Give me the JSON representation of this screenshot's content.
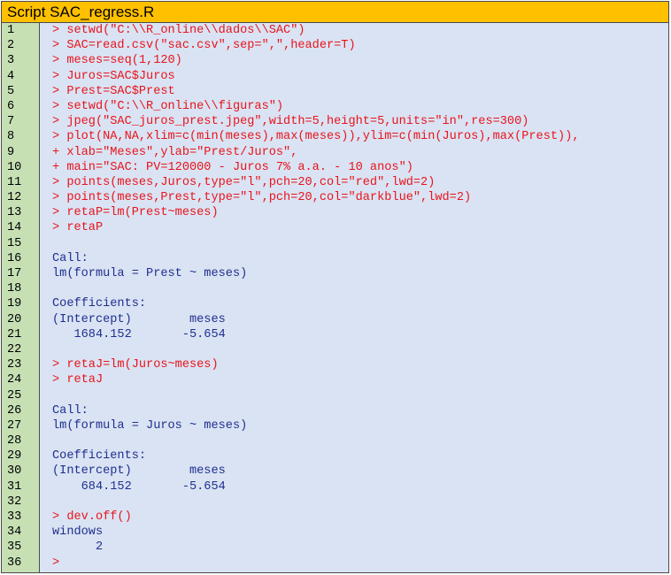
{
  "title": "Script SAC_regress.R",
  "colors": {
    "title_bg": "#ffc000",
    "gutter_bg": "#c6e0b4",
    "code_bg": "#dae3f3",
    "command": "#e8141c",
    "output": "#1f2f8f"
  },
  "lines": [
    {
      "n": "1",
      "text": "> setwd(\"C:\\\\R_online\\\\dados\\\\SAC\")",
      "kind": "cmd"
    },
    {
      "n": "2",
      "text": "> SAC=read.csv(\"sac.csv\",sep=\",\",header=T)",
      "kind": "cmd"
    },
    {
      "n": "3",
      "text": "> meses=seq(1,120)",
      "kind": "cmd"
    },
    {
      "n": "4",
      "text": "> Juros=SAC$Juros",
      "kind": "cmd"
    },
    {
      "n": "5",
      "text": "> Prest=SAC$Prest",
      "kind": "cmd"
    },
    {
      "n": "6",
      "text": "> setwd(\"C:\\\\R_online\\\\figuras\")",
      "kind": "cmd"
    },
    {
      "n": "7",
      "text": "> jpeg(\"SAC_juros_prest.jpeg\",width=5,height=5,units=\"in\",res=300)",
      "kind": "cmd"
    },
    {
      "n": "8",
      "text": "> plot(NA,NA,xlim=c(min(meses),max(meses)),ylim=c(min(Juros),max(Prest)),",
      "kind": "cmd"
    },
    {
      "n": "9",
      "text": "+ xlab=\"Meses\",ylab=\"Prest/Juros\",",
      "kind": "cmd"
    },
    {
      "n": "10",
      "text": "+ main=\"SAC: PV=120000 - Juros 7% a.a. - 10 anos\")",
      "kind": "cmd"
    },
    {
      "n": "11",
      "text": "> points(meses,Juros,type=\"l\",pch=20,col=\"red\",lwd=2)",
      "kind": "cmd"
    },
    {
      "n": "12",
      "text": "> points(meses,Prest,type=\"l\",pch=20,col=\"darkblue\",lwd=2)",
      "kind": "cmd"
    },
    {
      "n": "13",
      "text": "> retaP=lm(Prest~meses)",
      "kind": "cmd"
    },
    {
      "n": "14",
      "text": "> retaP",
      "kind": "cmd"
    },
    {
      "n": "15",
      "text": "",
      "kind": "out"
    },
    {
      "n": "16",
      "text": "Call:",
      "kind": "out"
    },
    {
      "n": "17",
      "text": "lm(formula = Prest ~ meses)",
      "kind": "out"
    },
    {
      "n": "18",
      "text": "",
      "kind": "out"
    },
    {
      "n": "19",
      "text": "Coefficients:",
      "kind": "out"
    },
    {
      "n": "20",
      "text": "(Intercept)        meses",
      "kind": "out"
    },
    {
      "n": "21",
      "text": "   1684.152       -5.654",
      "kind": "out"
    },
    {
      "n": "22",
      "text": "",
      "kind": "out"
    },
    {
      "n": "23",
      "text": "> retaJ=lm(Juros~meses)",
      "kind": "cmd"
    },
    {
      "n": "24",
      "text": "> retaJ",
      "kind": "cmd"
    },
    {
      "n": "25",
      "text": "",
      "kind": "out"
    },
    {
      "n": "26",
      "text": "Call:",
      "kind": "out"
    },
    {
      "n": "27",
      "text": "lm(formula = Juros ~ meses)",
      "kind": "out"
    },
    {
      "n": "28",
      "text": "",
      "kind": "out"
    },
    {
      "n": "29",
      "text": "Coefficients:",
      "kind": "out"
    },
    {
      "n": "30",
      "text": "(Intercept)        meses",
      "kind": "out"
    },
    {
      "n": "31",
      "text": "    684.152       -5.654",
      "kind": "out"
    },
    {
      "n": "32",
      "text": "",
      "kind": "out"
    },
    {
      "n": "33",
      "text": "> dev.off()",
      "kind": "cmd"
    },
    {
      "n": "34",
      "text": "windows",
      "kind": "out"
    },
    {
      "n": "35",
      "text": "      2",
      "kind": "out"
    },
    {
      "n": "36",
      "text": ">",
      "kind": "cmd"
    }
  ]
}
